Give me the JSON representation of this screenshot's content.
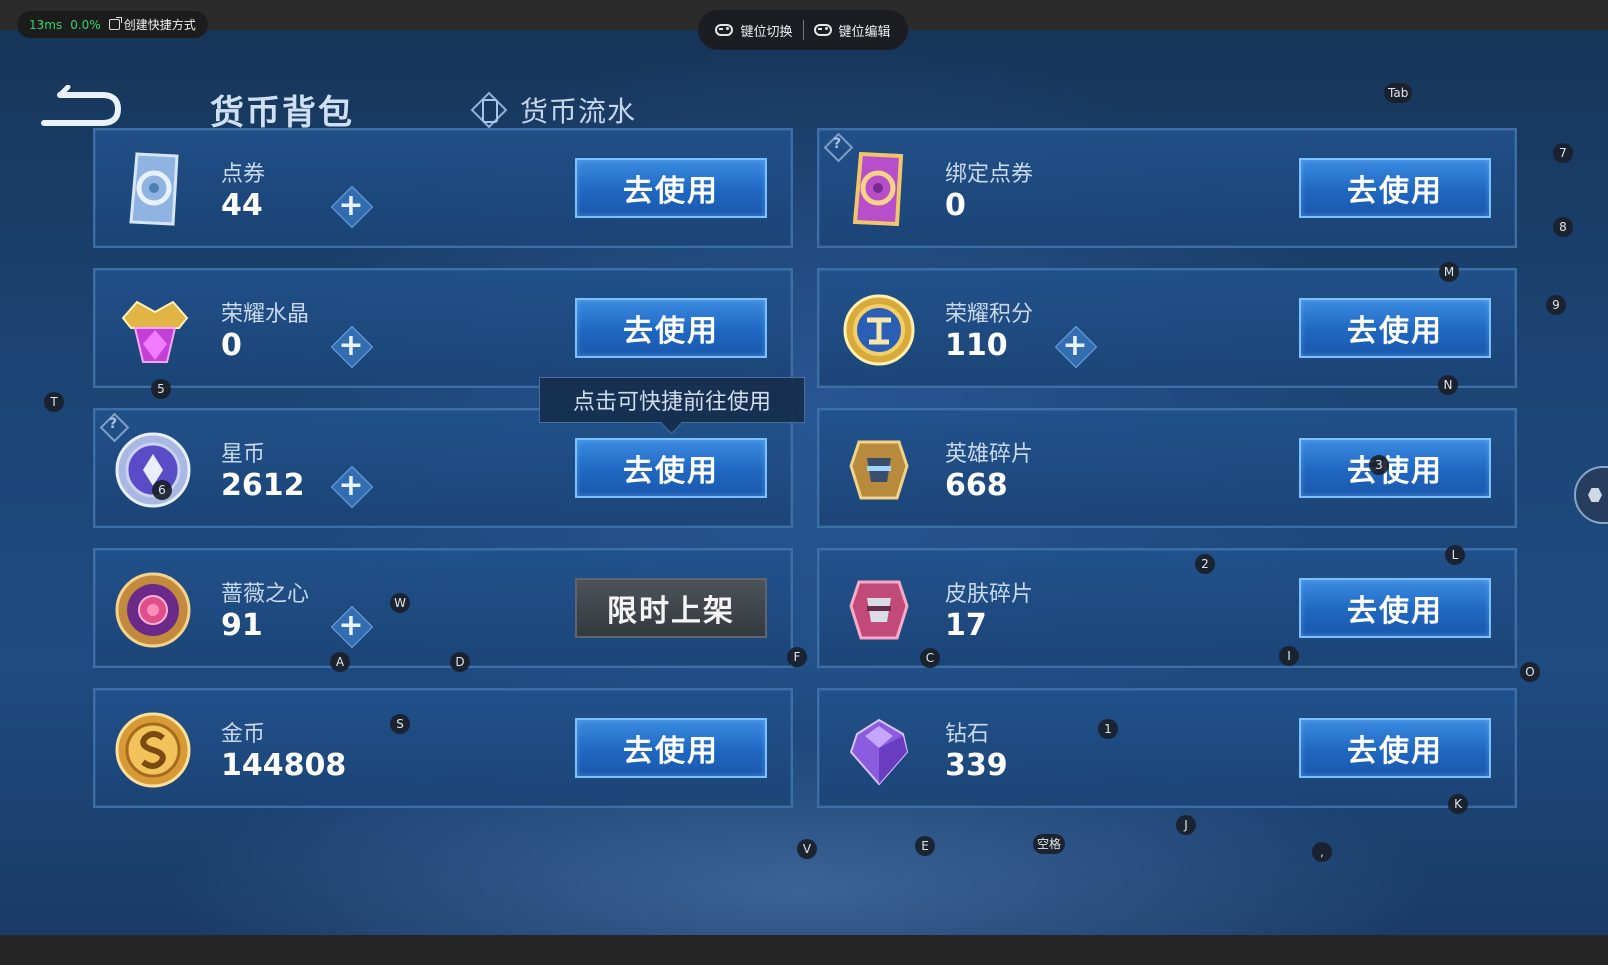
{
  "perf": {
    "latency": "13ms",
    "loss": "0.0%",
    "shortcut_label": "创建快捷方式"
  },
  "keymap": {
    "switch_label": "键位切换",
    "edit_label": "键位编辑"
  },
  "tabs": {
    "active": "货币背包",
    "inactive": "货币流水"
  },
  "tooltip": "点击可快捷前往使用",
  "cards": {
    "dianquan": {
      "name": "点券",
      "count": "44",
      "action": "去使用"
    },
    "bangding": {
      "name": "绑定点券",
      "count": "0",
      "action": "去使用"
    },
    "shuijing": {
      "name": "荣耀水晶",
      "count": "0",
      "action": "去使用"
    },
    "jifen": {
      "name": "荣耀积分",
      "count": "110",
      "action": "去使用"
    },
    "xingbi": {
      "name": "星币",
      "count": "2612",
      "action": "去使用"
    },
    "yingxiong": {
      "name": "英雄碎片",
      "count": "668",
      "action": "去使用"
    },
    "qiangwei": {
      "name": "蔷薇之心",
      "count": "91",
      "action": "限时上架"
    },
    "pifu": {
      "name": "皮肤碎片",
      "count": "17",
      "action": "去使用"
    },
    "jinbi": {
      "name": "金币",
      "count": "144808",
      "action": "去使用"
    },
    "zuanshi": {
      "name": "钻石",
      "count": "339",
      "action": "去使用"
    }
  },
  "plus_symbol": "+",
  "help_symbol": "?",
  "keys": {
    "tab": "Tab",
    "k7": "7",
    "k8": "8",
    "m": "M",
    "k9": "9",
    "t": "T",
    "k5": "5",
    "n": "N",
    "k6": "6",
    "k3": "3",
    "k2": "2",
    "l": "L",
    "w": "W",
    "a": "A",
    "d": "D",
    "f": "F",
    "c": "C",
    "i": "I",
    "o": "O",
    "s": "S",
    "k1": "1",
    "k": "K",
    "j": "J",
    "v": "V",
    "e": "E",
    "space": "空格",
    "comma": ","
  },
  "colors": {
    "use_button": "#1f67c2",
    "limited_button": "#34393e",
    "card_border": "#3e6ea6",
    "background": "#1c4576"
  }
}
